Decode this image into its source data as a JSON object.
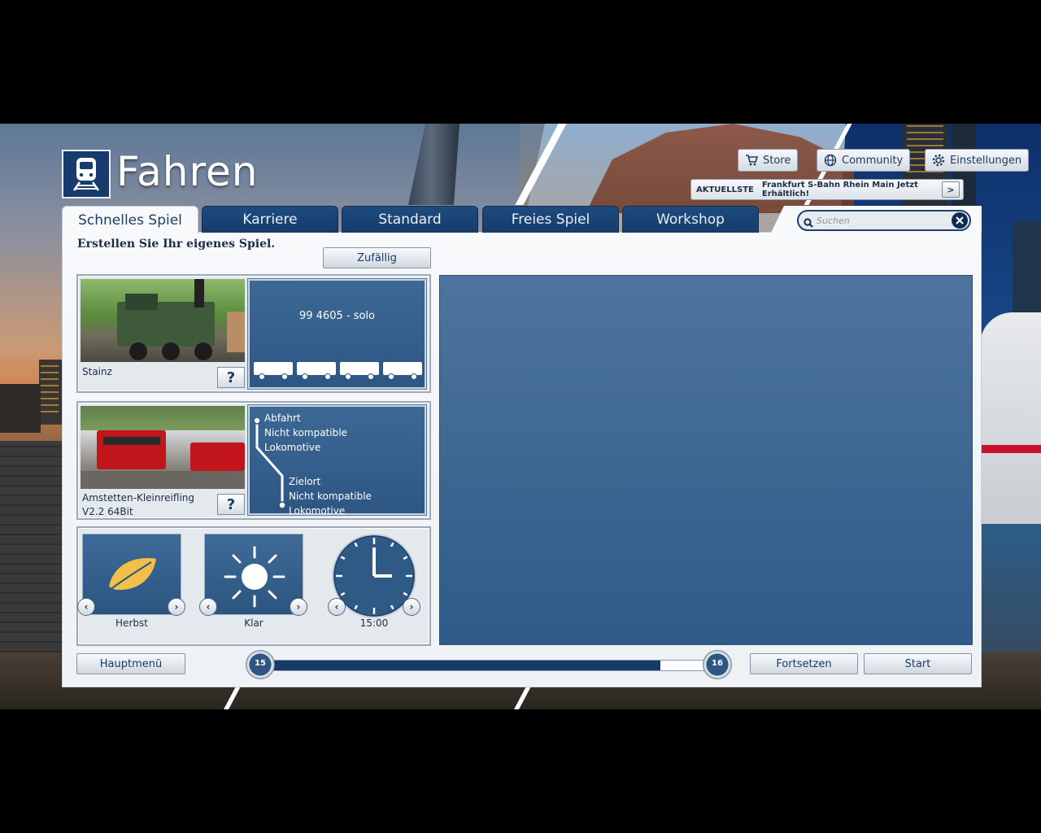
{
  "header": {
    "title": "Fahren",
    "store_label": "Store",
    "community_label": "Community",
    "settings_label": "Einstellungen"
  },
  "news": {
    "tag": "AKTUELLSTE",
    "text": "Frankfurt S-Bahn Rhein Main Jetzt Erhältlich!",
    "arrow": ">"
  },
  "tabs": [
    {
      "label": "Schnelles Spiel",
      "active": true
    },
    {
      "label": "Karriere",
      "active": false
    },
    {
      "label": "Standard",
      "active": false
    },
    {
      "label": "Freies Spiel",
      "active": false
    },
    {
      "label": "Workshop",
      "active": false
    }
  ],
  "search": {
    "placeholder": "Suchen"
  },
  "main": {
    "subtitle": "Erstellen Sie Ihr eigenes Spiel.",
    "random_label": "Zufällig",
    "loco": {
      "name": "Stainz",
      "consist": "99 4605 - solo",
      "help": "?"
    },
    "route": {
      "name_line1": "Amstetten-Kleinreifling",
      "name_line2": "V2.2 64Bit",
      "help": "?",
      "departure_title": "Abfahrt",
      "departure_line1": "Nicht kompatible",
      "departure_line2": "Lokomotive",
      "destination_title": "Zielort",
      "destination_line1": "Nicht kompatible",
      "destination_line2": "Lokomotive"
    },
    "season": "Herbst",
    "weather": "Klar",
    "time": "15:00"
  },
  "footer": {
    "main_menu_label": "Hauptmenü",
    "continue_label": "Fortsetzen",
    "start_label": "Start",
    "slider_min": "15",
    "slider_max": "16",
    "slider_fraction": 0.9
  },
  "colors": {
    "accent": "#173b6c",
    "panel_blue": "#2f5b88"
  }
}
